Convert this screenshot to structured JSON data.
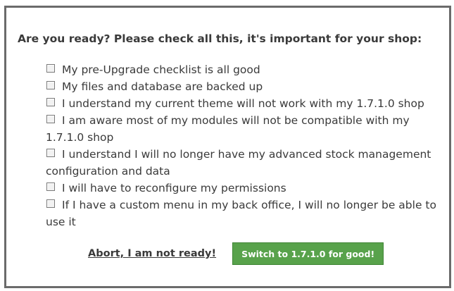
{
  "dialog": {
    "heading": "Are you ready? Please check all this, it's important for your shop:",
    "checklist": [
      {
        "label": "My pre-Upgrade checklist is all good",
        "checked": false
      },
      {
        "label": "My files and database are backed up",
        "checked": false
      },
      {
        "label": "I understand my current theme will not work with my 1.7.1.0 shop",
        "checked": false
      },
      {
        "label": "I am aware most of my modules will not be compatible with my 1.7.1.0 shop",
        "checked": false
      },
      {
        "label": "I understand I will no longer have my advanced stock management configuration and data",
        "checked": false
      },
      {
        "label": "I will have to reconfigure my permissions",
        "checked": false
      },
      {
        "label": "If I have a custom menu in my back office, I will no longer be able to use it",
        "checked": false
      }
    ],
    "abort_label": "Abort, I am not ready!",
    "confirm_label": "Switch to 1.7.1.0 for good!"
  },
  "colors": {
    "border": "#6b6b6b",
    "text": "#3a3a3a",
    "confirm_button": "#58a24b"
  }
}
